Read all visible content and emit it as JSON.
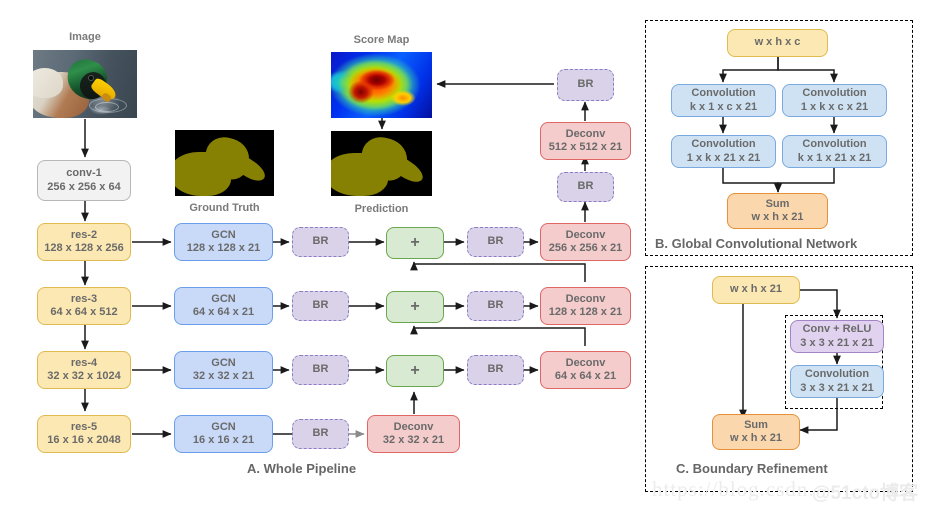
{
  "figure": {
    "section_captions": {
      "a": "A. Whole Pipeline",
      "b": "B. Global Convolutional Network",
      "c": "C. Boundary Refinement"
    },
    "image_captions": {
      "image": "Image",
      "ground_truth": "Ground Truth",
      "score_map": "Score Map",
      "prediction": "Prediction"
    },
    "watermark": {
      "url": "https://blog.csdn.",
      "handle": "@51cto博客"
    }
  },
  "pipeline": {
    "backbone": [
      {
        "name": "conv-1",
        "shape": "256 x 256 x 64"
      },
      {
        "name": "res-2",
        "shape": "128 x 128 x 256"
      },
      {
        "name": "res-3",
        "shape": "64 x 64 x 512"
      },
      {
        "name": "res-4",
        "shape": "32 x 32 x 1024"
      },
      {
        "name": "res-5",
        "shape": "16 x 16 x 2048"
      }
    ],
    "gcn": [
      {
        "name": "GCN",
        "shape": "128 x 128 x 21"
      },
      {
        "name": "GCN",
        "shape": "64 x 64 x 21"
      },
      {
        "name": "GCN",
        "shape": "32 x 32 x 21"
      },
      {
        "name": "GCN",
        "shape": "16 x 16 x 21"
      }
    ],
    "br_left": [
      "BR",
      "BR",
      "BR",
      "BR"
    ],
    "sum": [
      "+",
      "+",
      "+"
    ],
    "br_right": [
      "BR",
      "BR",
      "BR"
    ],
    "deconv": [
      {
        "name": "Deconv",
        "shape": "256 x 256 x 21"
      },
      {
        "name": "Deconv",
        "shape": "128 x 128 x 21"
      },
      {
        "name": "Deconv",
        "shape": "64 x 64 x 21"
      },
      {
        "name": "Deconv",
        "shape": "32 x 32 x 21"
      }
    ],
    "head": {
      "br_top": "BR",
      "deconv_512": {
        "name": "Deconv",
        "shape": "512 x 512 x 21"
      },
      "br_mid": "BR"
    }
  },
  "gcn_panel": {
    "input": {
      "name": "w x h x c"
    },
    "conv_left_top": {
      "name": "Convolution",
      "shape": "k x 1 x c x 21"
    },
    "conv_right_top": {
      "name": "Convolution",
      "shape": "1 x k x c x 21"
    },
    "conv_left_bottom": {
      "name": "Convolution",
      "shape": "1 x k x 21 x 21"
    },
    "conv_right_bottom": {
      "name": "Convolution",
      "shape": "k x 1 x 21 x 21"
    },
    "sum": {
      "name": "Sum",
      "shape": "w x h x 21"
    }
  },
  "br_panel": {
    "input": {
      "name": "w x h x 21"
    },
    "conv_relu": {
      "name": "Conv + ReLU",
      "shape": "3 x 3 x 21 x 21"
    },
    "conv": {
      "name": "Convolution",
      "shape": "3 x 3 x 21 x 21"
    },
    "sum": {
      "name": "Sum",
      "shape": "w x h x 21"
    }
  },
  "colors": {
    "backbone": "#fce8b2",
    "gcn": "#c9daf8",
    "br": "#d9d2e9",
    "sum": "#d9ead3",
    "deconv": "#f4cccc",
    "panel_sum": "#fbd7ad"
  }
}
